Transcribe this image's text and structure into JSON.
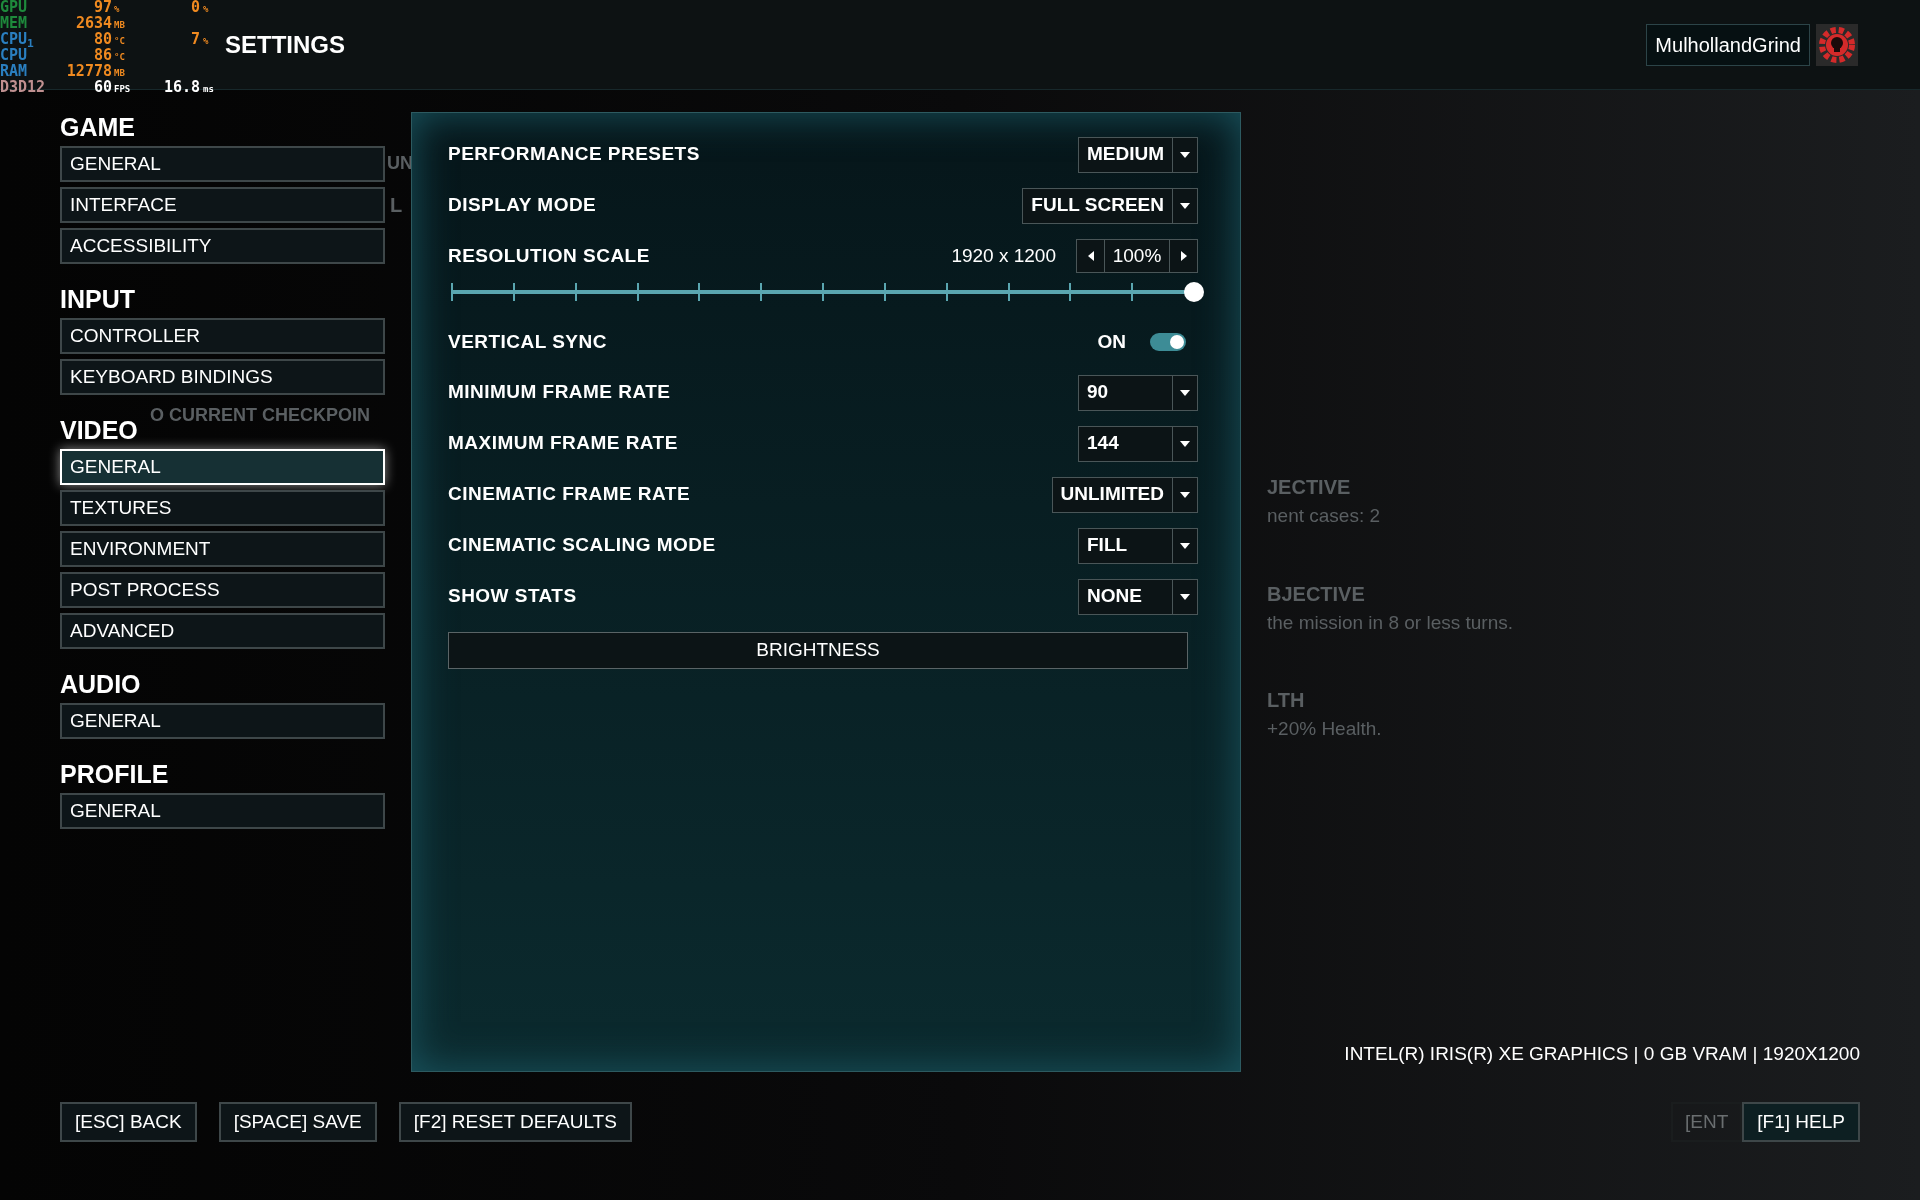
{
  "title": "SETTINGS",
  "user": {
    "name": "MulhollandGrind"
  },
  "hud": [
    {
      "label": "GPU",
      "color": "#1e8a3c",
      "kind": "sensor",
      "value": "97",
      "unit": "%",
      "value2": "0",
      "unit2": "%"
    },
    {
      "label": "MEM",
      "color": "#1e8a3c",
      "kind": "sensor",
      "value": "2634",
      "unit": "MB"
    },
    {
      "label": "CPU$_{1}$",
      "color": "#2a7fc0",
      "kind": "sensor",
      "value": "80",
      "unit": "°C",
      "value2": "7",
      "unit2": "%"
    },
    {
      "label": "CPU",
      "color": "#2a7fc0",
      "kind": "sensor",
      "value": "86",
      "unit": "°C"
    },
    {
      "label": "RAM",
      "color": "#2a7fc0",
      "kind": "sensor",
      "value": "12778",
      "unit": "MB"
    },
    {
      "label": "D3D12",
      "color": "#c09090",
      "kind": "frame",
      "value": "60",
      "unit": "FPS",
      "value2": "16.8",
      "unit2": "ms"
    }
  ],
  "nav": [
    {
      "heading": "GAME",
      "items": [
        {
          "label": "GENERAL",
          "selected": false
        },
        {
          "label": "INTERFACE",
          "selected": false
        },
        {
          "label": "ACCESSIBILITY",
          "selected": false
        }
      ]
    },
    {
      "heading": "INPUT",
      "items": [
        {
          "label": "CONTROLLER",
          "selected": false
        },
        {
          "label": "KEYBOARD BINDINGS",
          "selected": false
        }
      ]
    },
    {
      "heading": "VIDEO",
      "items": [
        {
          "label": "GENERAL",
          "selected": true
        },
        {
          "label": "TEXTURES",
          "selected": false
        },
        {
          "label": "ENVIRONMENT",
          "selected": false
        },
        {
          "label": "POST PROCESS",
          "selected": false
        },
        {
          "label": "ADVANCED",
          "selected": false
        }
      ]
    },
    {
      "heading": "AUDIO",
      "items": [
        {
          "label": "GENERAL",
          "selected": false
        }
      ]
    },
    {
      "heading": "PROFILE",
      "items": [
        {
          "label": "GENERAL",
          "selected": false
        }
      ]
    }
  ],
  "settings": [
    {
      "kind": "dropdown",
      "label": "PERFORMANCE PRESETS",
      "value": "MEDIUM"
    },
    {
      "kind": "dropdown",
      "label": "DISPLAY MODE",
      "value": "FULL SCREEN"
    },
    {
      "kind": "slider",
      "label": "RESOLUTION SCALE",
      "resolution": "1920 x 1200",
      "value": "100%",
      "level": 1
    },
    {
      "kind": "toggle",
      "label": "VERTICAL SYNC",
      "value": "ON",
      "on": true
    },
    {
      "kind": "dropdown",
      "label": "MINIMUM FRAME RATE",
      "value": "90"
    },
    {
      "kind": "dropdown",
      "label": "MAXIMUM FRAME RATE",
      "value": "144"
    },
    {
      "kind": "dropdown",
      "label": "CINEMATIC FRAME RATE",
      "value": "UNLIMITED"
    },
    {
      "kind": "dropdown",
      "label": "CINEMATIC SCALING MODE",
      "value": "FILL"
    },
    {
      "kind": "dropdown",
      "label": "SHOW STATS",
      "value": "NONE"
    },
    {
      "kind": "button",
      "label": "BRIGHTNESS"
    }
  ],
  "background_text": [
    {
      "kind": "left",
      "text": "UN"
    },
    {
      "kind": "left",
      "text": "L"
    },
    {
      "kind": "left",
      "text": "O CURRENT CHECKPOIN"
    },
    {
      "kind": "heading",
      "text": "JECTIVE"
    },
    {
      "kind": "body",
      "text": "nent cases: 2"
    },
    {
      "kind": "heading",
      "text": "BJECTIVE"
    },
    {
      "kind": "body",
      "text": "the mission in 8 or less turns."
    },
    {
      "kind": "heading",
      "text": "LTH"
    },
    {
      "kind": "body",
      "text": "+20% Health."
    }
  ],
  "system_info": "INTEL(R) IRIS(R) XE GRAPHICS | 0 GB VRAM | 1920X1200",
  "footer_left": [
    "[ESC] BACK",
    "[SPACE] SAVE",
    "[F2] RESET DEFAULTS"
  ],
  "footer_right": [
    {
      "label": "[ENT",
      "disabled": true
    },
    {
      "label": "[F1] HELP",
      "disabled": false
    }
  ]
}
